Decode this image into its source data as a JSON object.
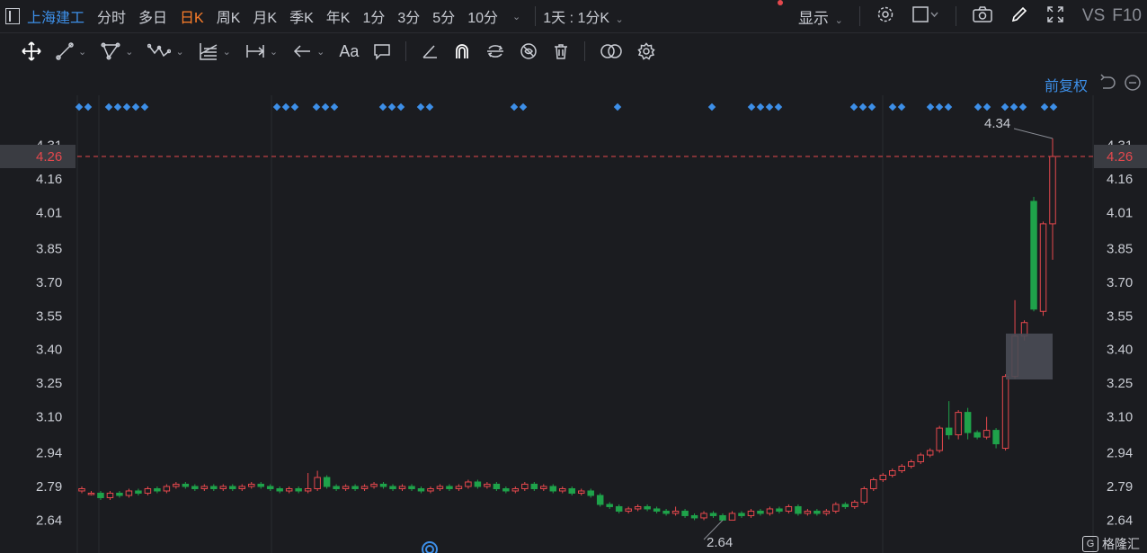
{
  "header": {
    "stock_name": "上海建工",
    "tabs": [
      "分时",
      "多日",
      "日K",
      "周K",
      "月K",
      "季K",
      "年K",
      "1分",
      "3分",
      "5分",
      "10分"
    ],
    "active_tab": "日K",
    "period_selector": "1天 : 1分K",
    "display_label": "显示",
    "vs_label": "VS",
    "f10_label": "F10"
  },
  "toolbar": {
    "text_tool_label": "Aa"
  },
  "adjust_label": "前复权",
  "watermark": "格隆汇",
  "colors": {
    "up": "#e5484d",
    "down": "#1fa24a",
    "accent": "#3d8fe8",
    "active_tab": "#ff7f2a",
    "price_line": "#e5484d"
  },
  "chart_data": {
    "type": "candlestick",
    "y_ticks": [
      "4.31",
      "4.16",
      "4.01",
      "3.85",
      "3.70",
      "3.55",
      "3.40",
      "3.25",
      "3.10",
      "2.94",
      "2.79",
      "2.64"
    ],
    "ylim": [
      2.58,
      4.4
    ],
    "current_price": "4.26",
    "max_label": "4.34",
    "min_label": "2.64",
    "grid": true,
    "candles": [
      [
        2.77,
        2.78,
        2.76,
        2.79
      ],
      [
        2.76,
        2.76,
        2.75,
        2.77
      ],
      [
        2.76,
        2.74,
        2.73,
        2.77
      ],
      [
        2.74,
        2.76,
        2.73,
        2.77
      ],
      [
        2.76,
        2.75,
        2.74,
        2.77
      ],
      [
        2.75,
        2.77,
        2.74,
        2.78
      ],
      [
        2.77,
        2.76,
        2.75,
        2.78
      ],
      [
        2.76,
        2.78,
        2.75,
        2.79
      ],
      [
        2.78,
        2.77,
        2.76,
        2.79
      ],
      [
        2.77,
        2.79,
        2.76,
        2.8
      ],
      [
        2.79,
        2.8,
        2.78,
        2.81
      ],
      [
        2.8,
        2.79,
        2.78,
        2.81
      ],
      [
        2.79,
        2.78,
        2.77,
        2.8
      ],
      [
        2.78,
        2.79,
        2.77,
        2.8
      ],
      [
        2.79,
        2.78,
        2.77,
        2.8
      ],
      [
        2.78,
        2.79,
        2.77,
        2.8
      ],
      [
        2.79,
        2.78,
        2.77,
        2.8
      ],
      [
        2.78,
        2.79,
        2.77,
        2.8
      ],
      [
        2.79,
        2.8,
        2.78,
        2.81
      ],
      [
        2.8,
        2.79,
        2.78,
        2.81
      ],
      [
        2.79,
        2.78,
        2.77,
        2.8
      ],
      [
        2.78,
        2.77,
        2.76,
        2.79
      ],
      [
        2.77,
        2.78,
        2.76,
        2.79
      ],
      [
        2.78,
        2.77,
        2.76,
        2.79
      ],
      [
        2.77,
        2.78,
        2.76,
        2.85
      ],
      [
        2.78,
        2.83,
        2.77,
        2.86
      ],
      [
        2.83,
        2.79,
        2.78,
        2.84
      ],
      [
        2.79,
        2.78,
        2.77,
        2.8
      ],
      [
        2.78,
        2.79,
        2.77,
        2.8
      ],
      [
        2.79,
        2.78,
        2.77,
        2.8
      ],
      [
        2.78,
        2.79,
        2.77,
        2.8
      ],
      [
        2.79,
        2.8,
        2.78,
        2.81
      ],
      [
        2.8,
        2.79,
        2.78,
        2.81
      ],
      [
        2.79,
        2.78,
        2.77,
        2.8
      ],
      [
        2.78,
        2.79,
        2.77,
        2.8
      ],
      [
        2.79,
        2.78,
        2.77,
        2.8
      ],
      [
        2.78,
        2.77,
        2.76,
        2.79
      ],
      [
        2.77,
        2.78,
        2.76,
        2.79
      ],
      [
        2.78,
        2.79,
        2.77,
        2.8
      ],
      [
        2.79,
        2.78,
        2.77,
        2.8
      ],
      [
        2.78,
        2.79,
        2.77,
        2.8
      ],
      [
        2.79,
        2.81,
        2.78,
        2.82
      ],
      [
        2.81,
        2.79,
        2.78,
        2.82
      ],
      [
        2.79,
        2.8,
        2.78,
        2.81
      ],
      [
        2.8,
        2.78,
        2.77,
        2.81
      ],
      [
        2.78,
        2.77,
        2.76,
        2.79
      ],
      [
        2.77,
        2.78,
        2.76,
        2.79
      ],
      [
        2.78,
        2.8,
        2.77,
        2.81
      ],
      [
        2.8,
        2.78,
        2.77,
        2.81
      ],
      [
        2.78,
        2.79,
        2.77,
        2.8
      ],
      [
        2.79,
        2.77,
        2.76,
        2.8
      ],
      [
        2.77,
        2.78,
        2.76,
        2.79
      ],
      [
        2.78,
        2.76,
        2.75,
        2.79
      ],
      [
        2.76,
        2.77,
        2.75,
        2.78
      ],
      [
        2.77,
        2.75,
        2.74,
        2.78
      ],
      [
        2.75,
        2.71,
        2.7,
        2.76
      ],
      [
        2.71,
        2.7,
        2.69,
        2.72
      ],
      [
        2.7,
        2.68,
        2.67,
        2.71
      ],
      [
        2.68,
        2.69,
        2.67,
        2.7
      ],
      [
        2.69,
        2.7,
        2.68,
        2.71
      ],
      [
        2.7,
        2.69,
        2.68,
        2.71
      ],
      [
        2.69,
        2.68,
        2.67,
        2.7
      ],
      [
        2.68,
        2.67,
        2.66,
        2.69
      ],
      [
        2.67,
        2.68,
        2.66,
        2.7
      ],
      [
        2.68,
        2.66,
        2.65,
        2.69
      ],
      [
        2.66,
        2.65,
        2.64,
        2.67
      ],
      [
        2.65,
        2.67,
        2.64,
        2.68
      ],
      [
        2.67,
        2.66,
        2.65,
        2.68
      ],
      [
        2.66,
        2.64,
        2.64,
        2.67
      ],
      [
        2.64,
        2.67,
        2.64,
        2.68
      ],
      [
        2.67,
        2.66,
        2.65,
        2.68
      ],
      [
        2.66,
        2.68,
        2.65,
        2.69
      ],
      [
        2.68,
        2.67,
        2.66,
        2.69
      ],
      [
        2.67,
        2.69,
        2.66,
        2.7
      ],
      [
        2.69,
        2.68,
        2.67,
        2.7
      ],
      [
        2.68,
        2.7,
        2.67,
        2.71
      ],
      [
        2.7,
        2.67,
        2.66,
        2.71
      ],
      [
        2.67,
        2.68,
        2.66,
        2.69
      ],
      [
        2.68,
        2.67,
        2.66,
        2.69
      ],
      [
        2.67,
        2.68,
        2.66,
        2.69
      ],
      [
        2.68,
        2.71,
        2.67,
        2.72
      ],
      [
        2.71,
        2.7,
        2.69,
        2.72
      ],
      [
        2.7,
        2.72,
        2.69,
        2.73
      ],
      [
        2.72,
        2.78,
        2.71,
        2.79
      ],
      [
        2.78,
        2.82,
        2.77,
        2.83
      ],
      [
        2.82,
        2.84,
        2.81,
        2.85
      ],
      [
        2.84,
        2.86,
        2.83,
        2.87
      ],
      [
        2.86,
        2.88,
        2.85,
        2.89
      ],
      [
        2.88,
        2.9,
        2.87,
        2.91
      ],
      [
        2.9,
        2.93,
        2.89,
        2.94
      ],
      [
        2.93,
        2.95,
        2.92,
        2.96
      ],
      [
        2.95,
        3.05,
        2.94,
        3.06
      ],
      [
        3.05,
        3.02,
        3.0,
        3.17
      ],
      [
        3.02,
        3.12,
        3.0,
        3.13
      ],
      [
        3.12,
        3.03,
        3.0,
        3.14
      ],
      [
        3.03,
        3.01,
        3.0,
        3.04
      ],
      [
        3.01,
        3.04,
        3.0,
        3.1
      ],
      [
        3.04,
        2.98,
        2.96,
        3.05
      ],
      [
        2.96,
        3.28,
        2.95,
        3.29
      ],
      [
        3.28,
        3.46,
        3.27,
        3.62
      ],
      [
        3.46,
        3.52,
        3.44,
        3.53
      ],
      [
        4.06,
        3.58,
        3.57,
        4.08
      ],
      [
        3.57,
        3.96,
        3.55,
        3.97
      ],
      [
        3.96,
        4.26,
        3.8,
        4.34
      ]
    ]
  }
}
